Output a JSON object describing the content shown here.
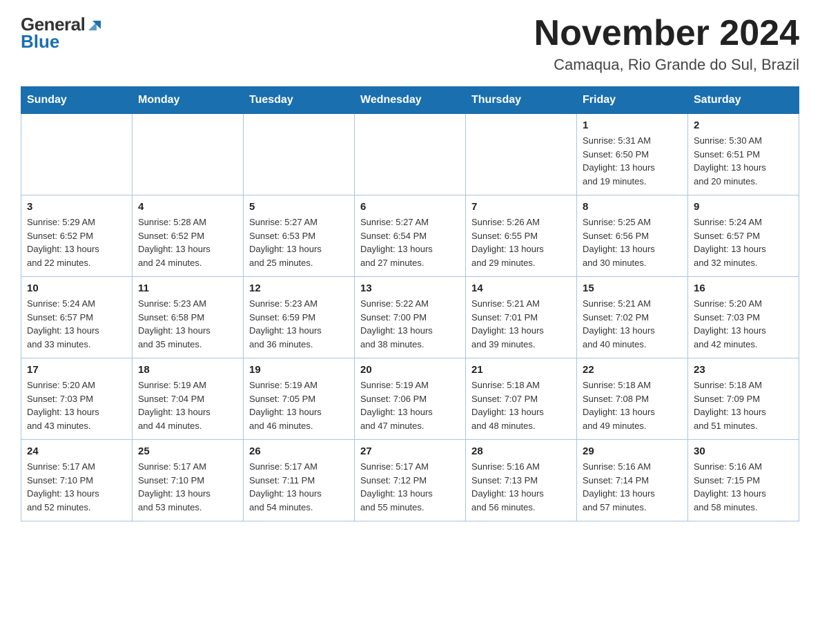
{
  "logo": {
    "part1": "General",
    "part2": "Blue"
  },
  "title": "November 2024",
  "subtitle": "Camaqua, Rio Grande do Sul, Brazil",
  "weekdays": [
    "Sunday",
    "Monday",
    "Tuesday",
    "Wednesday",
    "Thursday",
    "Friday",
    "Saturday"
  ],
  "weeks": [
    [
      {
        "day": "",
        "info": ""
      },
      {
        "day": "",
        "info": ""
      },
      {
        "day": "",
        "info": ""
      },
      {
        "day": "",
        "info": ""
      },
      {
        "day": "",
        "info": ""
      },
      {
        "day": "1",
        "info": "Sunrise: 5:31 AM\nSunset: 6:50 PM\nDaylight: 13 hours\nand 19 minutes."
      },
      {
        "day": "2",
        "info": "Sunrise: 5:30 AM\nSunset: 6:51 PM\nDaylight: 13 hours\nand 20 minutes."
      }
    ],
    [
      {
        "day": "3",
        "info": "Sunrise: 5:29 AM\nSunset: 6:52 PM\nDaylight: 13 hours\nand 22 minutes."
      },
      {
        "day": "4",
        "info": "Sunrise: 5:28 AM\nSunset: 6:52 PM\nDaylight: 13 hours\nand 24 minutes."
      },
      {
        "day": "5",
        "info": "Sunrise: 5:27 AM\nSunset: 6:53 PM\nDaylight: 13 hours\nand 25 minutes."
      },
      {
        "day": "6",
        "info": "Sunrise: 5:27 AM\nSunset: 6:54 PM\nDaylight: 13 hours\nand 27 minutes."
      },
      {
        "day": "7",
        "info": "Sunrise: 5:26 AM\nSunset: 6:55 PM\nDaylight: 13 hours\nand 29 minutes."
      },
      {
        "day": "8",
        "info": "Sunrise: 5:25 AM\nSunset: 6:56 PM\nDaylight: 13 hours\nand 30 minutes."
      },
      {
        "day": "9",
        "info": "Sunrise: 5:24 AM\nSunset: 6:57 PM\nDaylight: 13 hours\nand 32 minutes."
      }
    ],
    [
      {
        "day": "10",
        "info": "Sunrise: 5:24 AM\nSunset: 6:57 PM\nDaylight: 13 hours\nand 33 minutes."
      },
      {
        "day": "11",
        "info": "Sunrise: 5:23 AM\nSunset: 6:58 PM\nDaylight: 13 hours\nand 35 minutes."
      },
      {
        "day": "12",
        "info": "Sunrise: 5:23 AM\nSunset: 6:59 PM\nDaylight: 13 hours\nand 36 minutes."
      },
      {
        "day": "13",
        "info": "Sunrise: 5:22 AM\nSunset: 7:00 PM\nDaylight: 13 hours\nand 38 minutes."
      },
      {
        "day": "14",
        "info": "Sunrise: 5:21 AM\nSunset: 7:01 PM\nDaylight: 13 hours\nand 39 minutes."
      },
      {
        "day": "15",
        "info": "Sunrise: 5:21 AM\nSunset: 7:02 PM\nDaylight: 13 hours\nand 40 minutes."
      },
      {
        "day": "16",
        "info": "Sunrise: 5:20 AM\nSunset: 7:03 PM\nDaylight: 13 hours\nand 42 minutes."
      }
    ],
    [
      {
        "day": "17",
        "info": "Sunrise: 5:20 AM\nSunset: 7:03 PM\nDaylight: 13 hours\nand 43 minutes."
      },
      {
        "day": "18",
        "info": "Sunrise: 5:19 AM\nSunset: 7:04 PM\nDaylight: 13 hours\nand 44 minutes."
      },
      {
        "day": "19",
        "info": "Sunrise: 5:19 AM\nSunset: 7:05 PM\nDaylight: 13 hours\nand 46 minutes."
      },
      {
        "day": "20",
        "info": "Sunrise: 5:19 AM\nSunset: 7:06 PM\nDaylight: 13 hours\nand 47 minutes."
      },
      {
        "day": "21",
        "info": "Sunrise: 5:18 AM\nSunset: 7:07 PM\nDaylight: 13 hours\nand 48 minutes."
      },
      {
        "day": "22",
        "info": "Sunrise: 5:18 AM\nSunset: 7:08 PM\nDaylight: 13 hours\nand 49 minutes."
      },
      {
        "day": "23",
        "info": "Sunrise: 5:18 AM\nSunset: 7:09 PM\nDaylight: 13 hours\nand 51 minutes."
      }
    ],
    [
      {
        "day": "24",
        "info": "Sunrise: 5:17 AM\nSunset: 7:10 PM\nDaylight: 13 hours\nand 52 minutes."
      },
      {
        "day": "25",
        "info": "Sunrise: 5:17 AM\nSunset: 7:10 PM\nDaylight: 13 hours\nand 53 minutes."
      },
      {
        "day": "26",
        "info": "Sunrise: 5:17 AM\nSunset: 7:11 PM\nDaylight: 13 hours\nand 54 minutes."
      },
      {
        "day": "27",
        "info": "Sunrise: 5:17 AM\nSunset: 7:12 PM\nDaylight: 13 hours\nand 55 minutes."
      },
      {
        "day": "28",
        "info": "Sunrise: 5:16 AM\nSunset: 7:13 PM\nDaylight: 13 hours\nand 56 minutes."
      },
      {
        "day": "29",
        "info": "Sunrise: 5:16 AM\nSunset: 7:14 PM\nDaylight: 13 hours\nand 57 minutes."
      },
      {
        "day": "30",
        "info": "Sunrise: 5:16 AM\nSunset: 7:15 PM\nDaylight: 13 hours\nand 58 minutes."
      }
    ]
  ]
}
